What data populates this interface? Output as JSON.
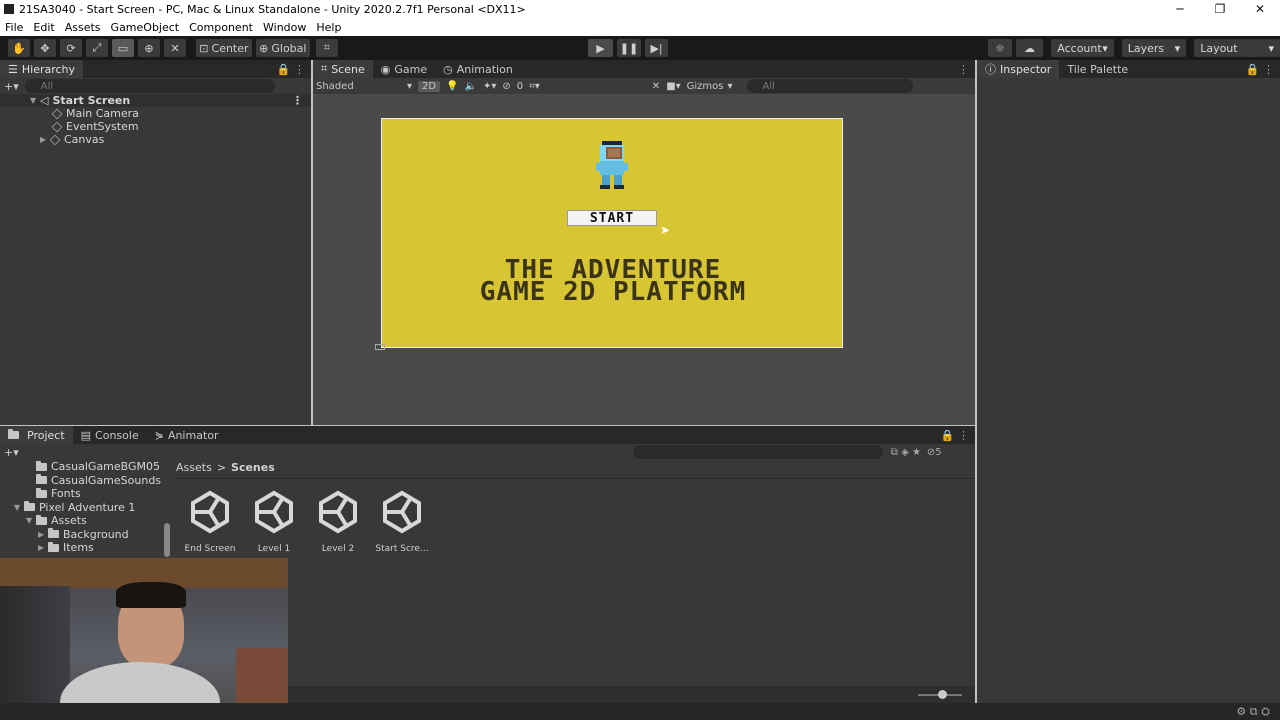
{
  "window": {
    "title": "21SA3040 - Start Screen - PC, Mac & Linux Standalone - Unity 2020.2.7f1 Personal <DX11>",
    "minimize": "─",
    "maximize": "❐",
    "close": "✕"
  },
  "menu": [
    "File",
    "Edit",
    "Assets",
    "GameObject",
    "Component",
    "Window",
    "Help"
  ],
  "toolbar": {
    "pivot": "Center",
    "space": "Global",
    "account": "Account",
    "layers": "Layers",
    "layout": "Layout"
  },
  "hierarchy": {
    "tab": "Hierarchy",
    "search_placeholder": "All",
    "scene": "Start Screen",
    "items": [
      "Main Camera",
      "EventSystem",
      "Canvas"
    ]
  },
  "scene_view": {
    "tabs": [
      "Scene",
      "Game",
      "Animation"
    ],
    "shading": "Shaded",
    "mode_2d": "2D",
    "hidden_count": "0",
    "gizmos": "Gizmos",
    "search_placeholder": "All"
  },
  "game_canvas": {
    "bg_color": "#d8c534",
    "start_button": "START",
    "title_line1": "THE ADVENTURE",
    "title_line2": "GAME 2D PLATFORM"
  },
  "inspector": {
    "tabs": [
      "Inspector",
      "Tile Palette"
    ]
  },
  "project": {
    "tabs": [
      "Project",
      "Console",
      "Animator"
    ],
    "breadcrumb_root": "Assets",
    "breadcrumb_sep": ">",
    "breadcrumb_current": "Scenes",
    "badge_count": "5",
    "tree": [
      {
        "label": "CasualGameBGM05",
        "indent": 1
      },
      {
        "label": "CasualGameSounds",
        "indent": 1
      },
      {
        "label": "Fonts",
        "indent": 1
      },
      {
        "label": "Pixel Adventure 1",
        "indent": 0
      },
      {
        "label": "Assets",
        "indent": 1
      },
      {
        "label": "Background",
        "indent": 2
      },
      {
        "label": "Items",
        "indent": 2
      }
    ],
    "scenes": [
      "End Screen",
      "Level 1",
      "Level 2",
      "Start Scre..."
    ]
  }
}
